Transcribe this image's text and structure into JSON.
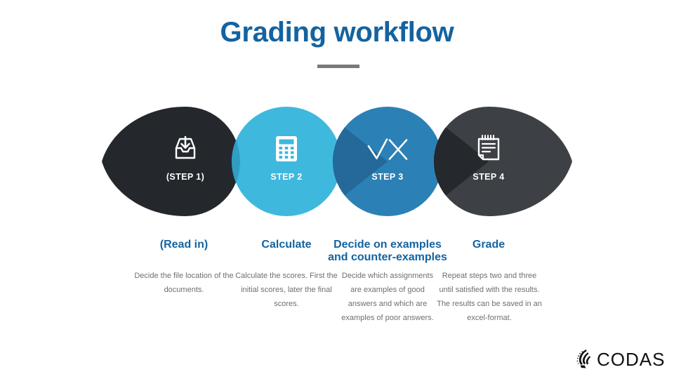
{
  "slide": {
    "title": "Grading workflow"
  },
  "steps": [
    {
      "label": "(STEP 1)",
      "icon": "inbox-download-icon",
      "shape": "leaf-left",
      "color": "#24282d",
      "heading": "(Read in)",
      "body": "Decide the file location of the documents."
    },
    {
      "label": "STEP 2",
      "icon": "calculator-icon",
      "shape": "circle",
      "color": "#3fb8de",
      "heading": "Calculate",
      "body": "Calculate the scores. First the initial scores, later the final scores."
    },
    {
      "label": "STEP 3",
      "icon": "check-cross-icon",
      "shape": "circle",
      "color": "#2b81b5",
      "heading": "Decide on examples and counter-examples",
      "body": "Decide which assignments are examples of good answers and which are examples of poor answers."
    },
    {
      "label": "STEP 4",
      "icon": "notepad-icon",
      "shape": "leaf-right",
      "color": "#3d4044",
      "heading": "Grade",
      "body": "Repeat steps two and three until satisfied with the results. The results can be saved in an excel-format."
    }
  ],
  "logo": {
    "wordmark": "CODAS",
    "mark_icon": "codas-bird-mark-icon"
  },
  "colors": {
    "title_blue": "#1463a0",
    "rule_gray": "#77797c",
    "body_gray": "#6d6f72",
    "step1": "#24282d",
    "step2": "#3fb8de",
    "step3": "#2b81b5",
    "step4": "#3d4044",
    "background": "#ffffff"
  }
}
